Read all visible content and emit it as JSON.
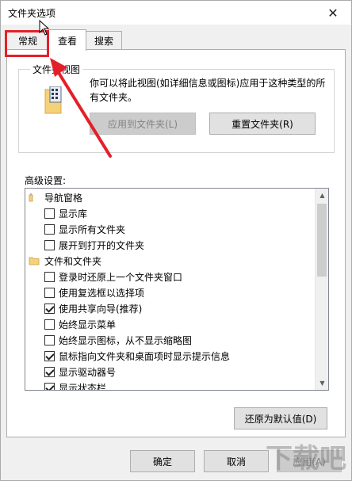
{
  "window": {
    "title": "文件夹选项",
    "close_glyph": "✕"
  },
  "tabs": [
    {
      "label": "常规",
      "active": false
    },
    {
      "label": "查看",
      "active": true
    },
    {
      "label": "搜索",
      "active": false
    }
  ],
  "folder_views": {
    "group_label": "文件夹视图",
    "description": "你可以将此视图(如详细信息或图标)应用于这种类型的所有文件夹。",
    "apply_button": "应用到文件夹(L)",
    "reset_button": "重置文件夹(R)"
  },
  "advanced": {
    "label": "高级设置:",
    "items": [
      {
        "type": "category",
        "label": "导航窗格",
        "icon": "navigation-pane-icon"
      },
      {
        "type": "option",
        "label": "显示库",
        "checked": false
      },
      {
        "type": "option",
        "label": "显示所有文件夹",
        "checked": false
      },
      {
        "type": "option",
        "label": "展开到打开的文件夹",
        "checked": false
      },
      {
        "type": "category",
        "label": "文件和文件夹",
        "icon": "folder-icon"
      },
      {
        "type": "option",
        "label": "登录时还原上一个文件夹窗口",
        "checked": false
      },
      {
        "type": "option",
        "label": "使用复选框以选择项",
        "checked": false
      },
      {
        "type": "option",
        "label": "使用共享向导(推荐)",
        "checked": true
      },
      {
        "type": "option",
        "label": "始终显示菜单",
        "checked": false
      },
      {
        "type": "option",
        "label": "始终显示图标，从不显示缩略图",
        "checked": false
      },
      {
        "type": "option",
        "label": "鼠标指向文件夹和桌面项时显示提示信息",
        "checked": true
      },
      {
        "type": "option",
        "label": "显示驱动器号",
        "checked": true
      },
      {
        "type": "option",
        "label": "显示状态栏",
        "checked": true
      }
    ]
  },
  "restore_button": "还原为默认值(D)",
  "footer": {
    "ok": "确定",
    "cancel": "取消",
    "apply": "应用(A)"
  },
  "watermark": "下载吧",
  "colors": {
    "highlight_red": "#e3202a",
    "focus_blue": "#0078d7"
  }
}
